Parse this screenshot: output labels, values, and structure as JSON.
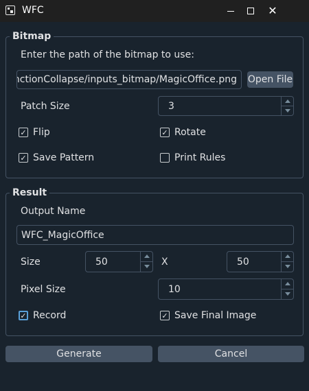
{
  "window": {
    "title": "WFC"
  },
  "bitmap": {
    "group_title": "Bitmap",
    "prompt": "Enter the path of the bitmap to use:",
    "path_value": "nctionCollapse/inputs_bitmap/MagicOffice.png",
    "open_file_label": "Open File",
    "patch_size_label": "Patch Size",
    "patch_size_value": "3",
    "flip_label": "Flip",
    "flip_checked": true,
    "rotate_label": "Rotate",
    "rotate_checked": true,
    "save_pattern_label": "Save Pattern",
    "save_pattern_checked": true,
    "print_rules_label": "Print Rules",
    "print_rules_checked": false
  },
  "result": {
    "group_title": "Result",
    "output_name_label": "Output Name",
    "output_name_value": "WFC_MagicOffice",
    "size_label": "Size",
    "size_x_value": "50",
    "x_label": "X",
    "size_y_value": "50",
    "pixel_size_label": "Pixel Size",
    "pixel_size_value": "10",
    "record_label": "Record",
    "record_checked": true,
    "save_final_label": "Save Final Image",
    "save_final_checked": true
  },
  "actions": {
    "generate_label": "Generate",
    "cancel_label": "Cancel"
  },
  "colors": {
    "background": "#19232d",
    "border": "#455364",
    "button": "#455364",
    "accent": "#5aa0d8"
  }
}
